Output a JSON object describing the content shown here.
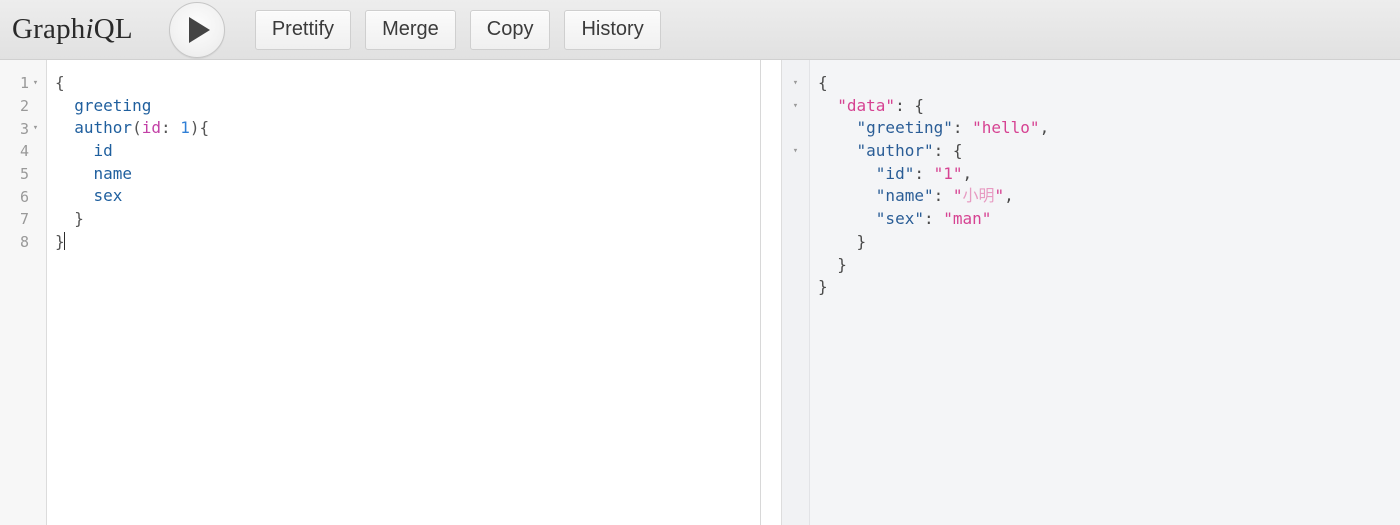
{
  "app": {
    "logo_prefix": "Graph",
    "logo_italic": "i",
    "logo_suffix": "QL"
  },
  "toolbar": {
    "execute_label": "▶",
    "execute_name": "execute-query-button",
    "buttons": [
      {
        "label": "Prettify",
        "name": "prettify-button"
      },
      {
        "label": "Merge",
        "name": "merge-button"
      },
      {
        "label": "Copy",
        "name": "copy-button"
      },
      {
        "label": "History",
        "name": "history-button"
      }
    ]
  },
  "query_editor": {
    "line_numbers": [
      "1",
      "2",
      "3",
      "4",
      "5",
      "6",
      "7",
      "8"
    ],
    "fold_markers": [
      true,
      false,
      true,
      false,
      false,
      false,
      false,
      false
    ],
    "fold_glyph": "▾",
    "lines": [
      {
        "number": "1",
        "tokens": [
          {
            "t": "{",
            "c": "t-punct"
          }
        ]
      },
      {
        "number": "2",
        "tokens": [
          {
            "t": "  ",
            "c": "t-punct"
          },
          {
            "t": "greeting",
            "c": "t-field"
          }
        ]
      },
      {
        "number": "3",
        "tokens": [
          {
            "t": "  ",
            "c": "t-punct"
          },
          {
            "t": "author",
            "c": "t-field"
          },
          {
            "t": "(",
            "c": "t-punct"
          },
          {
            "t": "id",
            "c": "t-arg"
          },
          {
            "t": ": ",
            "c": "t-punct"
          },
          {
            "t": "1",
            "c": "t-num"
          },
          {
            "t": "){",
            "c": "t-punct"
          }
        ]
      },
      {
        "number": "4",
        "tokens": [
          {
            "t": "    ",
            "c": "t-punct"
          },
          {
            "t": "id",
            "c": "t-field"
          }
        ]
      },
      {
        "number": "5",
        "tokens": [
          {
            "t": "    ",
            "c": "t-punct"
          },
          {
            "t": "name",
            "c": "t-field"
          }
        ]
      },
      {
        "number": "6",
        "tokens": [
          {
            "t": "    ",
            "c": "t-punct"
          },
          {
            "t": "sex",
            "c": "t-field"
          }
        ]
      },
      {
        "number": "7",
        "tokens": [
          {
            "t": "  }",
            "c": "t-punct"
          }
        ]
      },
      {
        "number": "8",
        "tokens": [
          {
            "t": "}",
            "c": "t-punct"
          }
        ],
        "caret": true
      }
    ],
    "plain_text": "{\n  greeting\n  author(id: 1){\n    id\n    name\n    sex\n  }\n}"
  },
  "result_viewer": {
    "fold_glyph": "▾",
    "fold_rows": [
      true,
      true,
      false,
      true,
      false,
      false,
      false,
      false,
      false,
      false
    ],
    "lines": [
      {
        "tokens": [
          {
            "t": "{",
            "c": "r-punct"
          }
        ]
      },
      {
        "tokens": [
          {
            "t": "  ",
            "c": "r-punct"
          },
          {
            "t": "\"data\"",
            "c": "r-topkey"
          },
          {
            "t": ": {",
            "c": "r-punct"
          }
        ]
      },
      {
        "tokens": [
          {
            "t": "    ",
            "c": "r-punct"
          },
          {
            "t": "\"greeting\"",
            "c": "r-key"
          },
          {
            "t": ": ",
            "c": "r-punct"
          },
          {
            "t": "\"hello\"",
            "c": "r-str"
          },
          {
            "t": ",",
            "c": "r-punct"
          }
        ]
      },
      {
        "tokens": [
          {
            "t": "    ",
            "c": "r-punct"
          },
          {
            "t": "\"author\"",
            "c": "r-key"
          },
          {
            "t": ": {",
            "c": "r-punct"
          }
        ]
      },
      {
        "tokens": [
          {
            "t": "      ",
            "c": "r-punct"
          },
          {
            "t": "\"id\"",
            "c": "r-key"
          },
          {
            "t": ": ",
            "c": "r-punct"
          },
          {
            "t": "\"1\"",
            "c": "r-str"
          },
          {
            "t": ",",
            "c": "r-punct"
          }
        ]
      },
      {
        "tokens": [
          {
            "t": "      ",
            "c": "r-punct"
          },
          {
            "t": "\"name\"",
            "c": "r-key"
          },
          {
            "t": ": ",
            "c": "r-punct"
          },
          {
            "t": "\"",
            "c": "r-str"
          },
          {
            "t": "小明",
            "c": "r-str-cjk"
          },
          {
            "t": "\"",
            "c": "r-str"
          },
          {
            "t": ",",
            "c": "r-punct"
          }
        ]
      },
      {
        "tokens": [
          {
            "t": "      ",
            "c": "r-punct"
          },
          {
            "t": "\"sex\"",
            "c": "r-key"
          },
          {
            "t": ": ",
            "c": "r-punct"
          },
          {
            "t": "\"man\"",
            "c": "r-str"
          }
        ]
      },
      {
        "tokens": [
          {
            "t": "    }",
            "c": "r-punct"
          }
        ]
      },
      {
        "tokens": [
          {
            "t": "  }",
            "c": "r-punct"
          }
        ]
      },
      {
        "tokens": [
          {
            "t": "}",
            "c": "r-punct"
          }
        ]
      }
    ],
    "plain_text": "{\n  \"data\": {\n    \"greeting\": \"hello\",\n    \"author\": {\n      \"id\": \"1\",\n      \"name\": \"小明\",\n      \"sex\": \"man\"\n    }\n  }\n}",
    "response": {
      "data": {
        "greeting": "hello",
        "author": {
          "id": "1",
          "name": "小明",
          "sex": "man"
        }
      }
    }
  },
  "colors": {
    "header_bg": "#e4e4e4",
    "query_bg": "#ffffff",
    "result_bg": "#f4f5f7",
    "gutter_bg": "#f7f7f7",
    "field_blue": "#1f5f9e",
    "arg_magenta": "#c340a6",
    "number_blue": "#2f7fd6",
    "json_key_blue": "#2a5d96",
    "json_string_pink": "#d64292"
  }
}
